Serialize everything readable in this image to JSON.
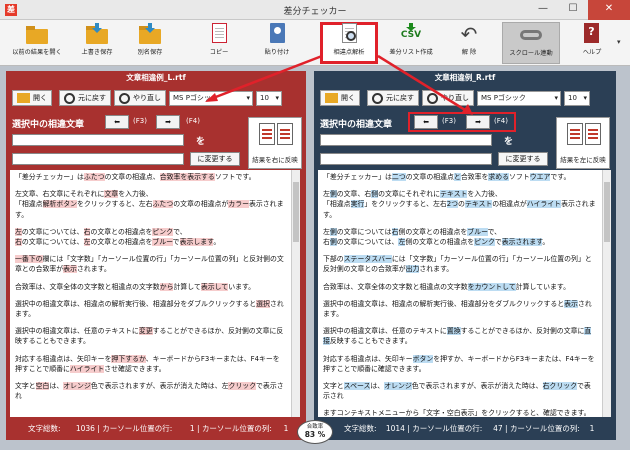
{
  "window": {
    "title": "差分チェッカー",
    "app_icon": "差",
    "min": "—",
    "max": "☐",
    "close": "✕"
  },
  "toolbar": {
    "open_prev": "以前の結果を開く",
    "overwrite_save": "上書き保存",
    "save_as": "別名保存",
    "copy": "コピー",
    "paste": "貼り付け",
    "analyze": "相違点解析",
    "csv_icon": "CSV",
    "csv": "差分リスト作成",
    "undo": "解 除",
    "scroll_link": "スクロール連動",
    "help": "ヘルプ"
  },
  "left": {
    "header": "文章相違例_L.rtf",
    "open": "開く",
    "undo": "元に戻す",
    "redo": "やり直し",
    "font": "MS Pゴシック",
    "size": "10",
    "sel_title": "選択中の相違文章",
    "prev": "(F3)",
    "next": "(F4)",
    "wo": "を",
    "change": "に変更する",
    "reflect": "結果を右に反映",
    "status": {
      "chars_label": "文字総数:",
      "chars": "1036",
      "pos_label": "カーソール位置の行:",
      "row": "1",
      "col_label": "カーソール位置の列:",
      "col": "1"
    },
    "text": [
      [
        [
          "「差分チェッカー」は",
          ""
        ],
        [
          "ふたつ",
          "l"
        ],
        [
          "の文章の相違点、",
          ""
        ],
        [
          "合致率を表示する",
          "l"
        ],
        [
          "ソフトです。",
          ""
        ]
      ],
      [
        [
          "左文章、右文章にそれぞれに",
          ""
        ],
        [
          "文章",
          "l"
        ],
        [
          "を入力後、",
          ""
        ]
      ],
      [
        [
          "「相違点",
          ""
        ],
        [
          "解析ボタン",
          "l"
        ],
        [
          "をクリックすると、左右",
          ""
        ],
        [
          "ふたつ",
          "l"
        ],
        [
          "の文章の相違点が",
          ""
        ],
        [
          "カラー",
          "l"
        ],
        [
          "表示されます。",
          ""
        ]
      ],
      [
        [
          "左",
          "l"
        ],
        [
          "の文章については、",
          ""
        ],
        [
          "右",
          "l"
        ],
        [
          "の文章との相違点を",
          ""
        ],
        [
          "ピンク",
          "l"
        ],
        [
          "で、",
          ""
        ]
      ],
      [
        [
          "右",
          "l"
        ],
        [
          "の文章については、",
          ""
        ],
        [
          "左",
          "l"
        ],
        [
          "の文章との相違点を",
          ""
        ],
        [
          "ブルー",
          "l"
        ],
        [
          "で",
          ""
        ],
        [
          "表示します",
          "l"
        ],
        [
          "。",
          ""
        ]
      ],
      [
        [
          "一番下の",
          "l"
        ],
        [
          "欄には「文字数」「カーソール位置の行」「カーソール位置の列」と反対側の文章との合致率が",
          ""
        ],
        [
          "表示",
          "l"
        ],
        [
          "されます。",
          ""
        ]
      ],
      [
        [
          "合致率は、文章全体の文字数と相違点の文字数",
          ""
        ],
        [
          "から",
          "l"
        ],
        [
          "計算して",
          ""
        ],
        [
          "表示して",
          "l"
        ],
        [
          "います。",
          ""
        ]
      ],
      [
        [
          "選択中の相違文章は、相違点の解析実行後、相違部分をダブルクリックすると",
          ""
        ],
        [
          "選択",
          "l"
        ],
        [
          "されます。",
          ""
        ]
      ],
      [
        [
          "選択中の相違文章は、任意のテキストに",
          ""
        ],
        [
          "変更",
          "l"
        ],
        [
          "することができるほか、反対側の文章に反映することもできます。",
          ""
        ]
      ],
      [
        [
          "対応する相違点は、矢印キーを",
          ""
        ],
        [
          "押下するか",
          "l"
        ],
        [
          "、キーボードからF3キーまたは、F4キーを押すことで順番に",
          ""
        ],
        [
          "ハイライト",
          "l"
        ],
        [
          "させ確認できます。",
          ""
        ]
      ],
      [
        [
          "文字と",
          ""
        ],
        [
          "空白",
          "l"
        ],
        [
          "は、",
          ""
        ],
        [
          "オレンジ",
          "l"
        ],
        [
          "色で表示されますが、表示が消えた時は、左",
          ""
        ],
        [
          "クリック",
          "l"
        ],
        [
          "で表示され",
          ""
        ]
      ]
    ]
  },
  "right": {
    "header": "文章相違例_R.rtf",
    "open": "開く",
    "undo": "元に戻す",
    "redo": "やり直し",
    "font": "MS Pゴシック",
    "size": "10",
    "sel_title": "選択中の相違文章",
    "prev": "(F3)",
    "next": "(F4)",
    "wo": "を",
    "change": "に変更する",
    "reflect": "結果を左に反映",
    "status": {
      "chars_label": "文字総数:",
      "chars": "1014",
      "pos_label": "カーソール位置の行:",
      "row": "47",
      "col_label": "カーソール位置の列:",
      "col": "1"
    },
    "text": [
      [
        [
          "「差分チェッカー」は",
          ""
        ],
        [
          "二つ",
          "r"
        ],
        [
          "の文章の相違点",
          ""
        ],
        [
          "と",
          "r"
        ],
        [
          "合致率を",
          ""
        ],
        [
          "求める",
          "r"
        ],
        [
          "ソフト",
          ""
        ],
        [
          "ウエア",
          "r"
        ],
        [
          "です。",
          ""
        ]
      ],
      [
        [
          "左",
          ""
        ],
        [
          "側",
          "r"
        ],
        [
          "の文章、右",
          ""
        ],
        [
          "側",
          "r"
        ],
        [
          "の文章にそれぞれに",
          ""
        ],
        [
          "テキスト",
          "r"
        ],
        [
          "を入力後、",
          ""
        ]
      ],
      [
        [
          "「相違点",
          ""
        ],
        [
          "実行",
          "r"
        ],
        [
          "」をクリックすると、左右",
          ""
        ],
        [
          "2つ",
          "r"
        ],
        [
          "の",
          ""
        ],
        [
          "テキスト",
          "r"
        ],
        [
          "の相違点が",
          ""
        ],
        [
          "ハイライト",
          "r"
        ],
        [
          "表示されます。",
          ""
        ]
      ],
      [
        [
          "左",
          ""
        ],
        [
          "側",
          "r"
        ],
        [
          "の文章については",
          ""
        ],
        [
          "右",
          "r"
        ],
        [
          "側の文章との相違点を",
          ""
        ],
        [
          "ブルー",
          "r"
        ],
        [
          "で、",
          ""
        ]
      ],
      [
        [
          "右",
          ""
        ],
        [
          "側",
          "r"
        ],
        [
          "の文章については、",
          ""
        ],
        [
          "左",
          "r"
        ],
        [
          "側の文章との相違点を",
          ""
        ],
        [
          "ピンク",
          "r"
        ],
        [
          "で",
          ""
        ],
        [
          "表示されます",
          "r"
        ],
        [
          "。",
          ""
        ]
      ],
      [
        [
          "下部の",
          ""
        ],
        [
          "ステータスバー",
          "r"
        ],
        [
          "には「文字数」「カーソール位置の行」「カーソール位置の列」と反対側の文章との合致率が",
          ""
        ],
        [
          "出力",
          "r"
        ],
        [
          "されます。",
          ""
        ]
      ],
      [
        [
          "合致率は、文章全体の文字数と相違点の文字数",
          ""
        ],
        [
          "をカウントして",
          "r"
        ],
        [
          "計算しています。",
          ""
        ]
      ],
      [
        [
          "選択中の相違文章は、相違点の解析実行後、相違部分をダブルクリックすると",
          ""
        ],
        [
          "表示",
          "r"
        ],
        [
          "されます。",
          ""
        ]
      ],
      [
        [
          "選択中の相違文章は、任意のテキストに",
          ""
        ],
        [
          "置換",
          "r"
        ],
        [
          "することができるほか、反対側の文章に",
          ""
        ],
        [
          "直接",
          "r"
        ],
        [
          "反映することもできます。",
          ""
        ]
      ],
      [
        [
          "対応する相違点は、矢印キー",
          ""
        ],
        [
          "ボタン",
          "r"
        ],
        [
          "を押すか、キーボードからF3キーまたは、F4キーを押すことで順番に確認できます。",
          ""
        ]
      ],
      [
        [
          "文字と",
          ""
        ],
        [
          "スペース",
          "r"
        ],
        [
          "は、",
          ""
        ],
        [
          "オレンジ",
          "r"
        ],
        [
          "色で表示されますが、表示が消えた時は、",
          ""
        ],
        [
          "右クリック",
          "r"
        ],
        [
          "で表示され",
          ""
        ]
      ],
      [
        [
          "ますコンテキストメニューから「文字・空白表示」をクリックすると、確認できます。目に",
          ""
        ]
      ]
    ]
  },
  "match": {
    "label": "合致率",
    "value": "83 %"
  }
}
